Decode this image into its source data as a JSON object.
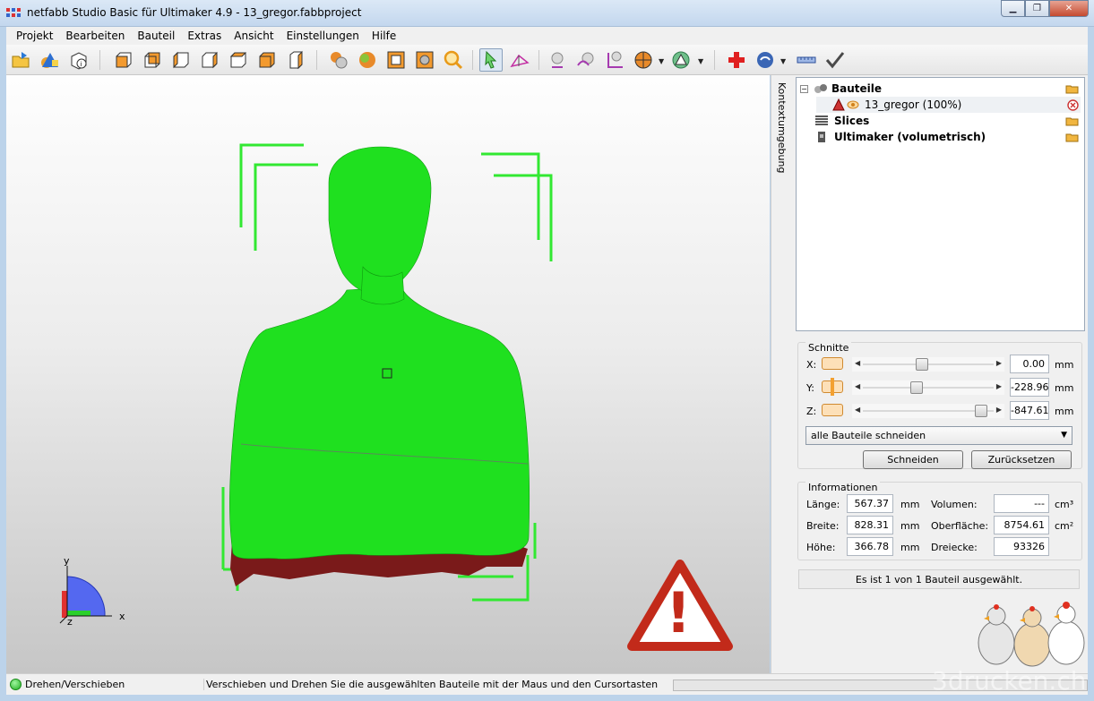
{
  "window": {
    "title": "netfabb Studio Basic für Ultimaker 4.9 - 13_gregor.fabbproject",
    "buttons": [
      "minimize",
      "maximize",
      "close"
    ]
  },
  "menu": [
    "Projekt",
    "Bearbeiten",
    "Bauteil",
    "Extras",
    "Ansicht",
    "Einstellungen",
    "Hilfe"
  ],
  "toolbar": {
    "icons": [
      "open-project-icon",
      "add-part-icon",
      "part-info-icon",
      "view-front-icon",
      "view-back-icon",
      "view-left-icon",
      "view-right-icon",
      "view-top-icon",
      "view-bottom-icon",
      "view-perspective-icon",
      "render-spheres-icon",
      "render-solid-icon",
      "render-wireframe-icon",
      "render-cube-icon",
      "zoom-icon",
      "select-arrow-icon",
      "measure-plane-icon",
      "move-icon",
      "rotate-icon",
      "scale-icon",
      "color-icon",
      "repair-warning-icon",
      "repair-cross-icon",
      "shell-icon",
      "ruler-icon",
      "check-icon"
    ]
  },
  "side_tab": {
    "label": "Kontextumgebung"
  },
  "tree": {
    "root": "Bauteile",
    "part": "13_gregor (100%)",
    "slices": "Slices",
    "machine": "Ultimaker (volumetrisch)"
  },
  "schnitte": {
    "title": "Schnitte",
    "x_label": "X:",
    "y_label": "Y:",
    "z_label": "Z:",
    "x_value": "0.00",
    "y_value": "-228.96",
    "z_value": "-847.61",
    "unit": "mm",
    "x_slider": 0.45,
    "y_slider": 0.4,
    "z_slider": 0.95,
    "mode": "alle Bauteile schneiden",
    "cut_button": "Schneiden",
    "reset_button": "Zurücksetzen"
  },
  "info": {
    "title": "Informationen",
    "length_label": "Länge:",
    "length_value": "567.37",
    "width_label": "Breite:",
    "width_value": "828.31",
    "height_label": "Höhe:",
    "height_value": "366.78",
    "unit": "mm",
    "volume_label": "Volumen:",
    "volume_value": "---",
    "area_label": "Oberfläche:",
    "area_value": "8754.61",
    "area_unit": "cm²",
    "volume_unit": "cm³",
    "triangles_label": "Dreiecke:",
    "triangles_value": "93326",
    "selection_status": "Es ist 1 von 1 Bauteil ausgewählt."
  },
  "viewport": {
    "axis_x": "x",
    "axis_y": "y",
    "axis_z": "z",
    "warning_glyph": "!"
  },
  "statusbar": {
    "mode": "Drehen/Verschieben",
    "message": "Verschieben und Drehen Sie die ausgewählten Bauteile mit der Maus und den Cursortasten"
  },
  "watermark": "3drucken.ch"
}
